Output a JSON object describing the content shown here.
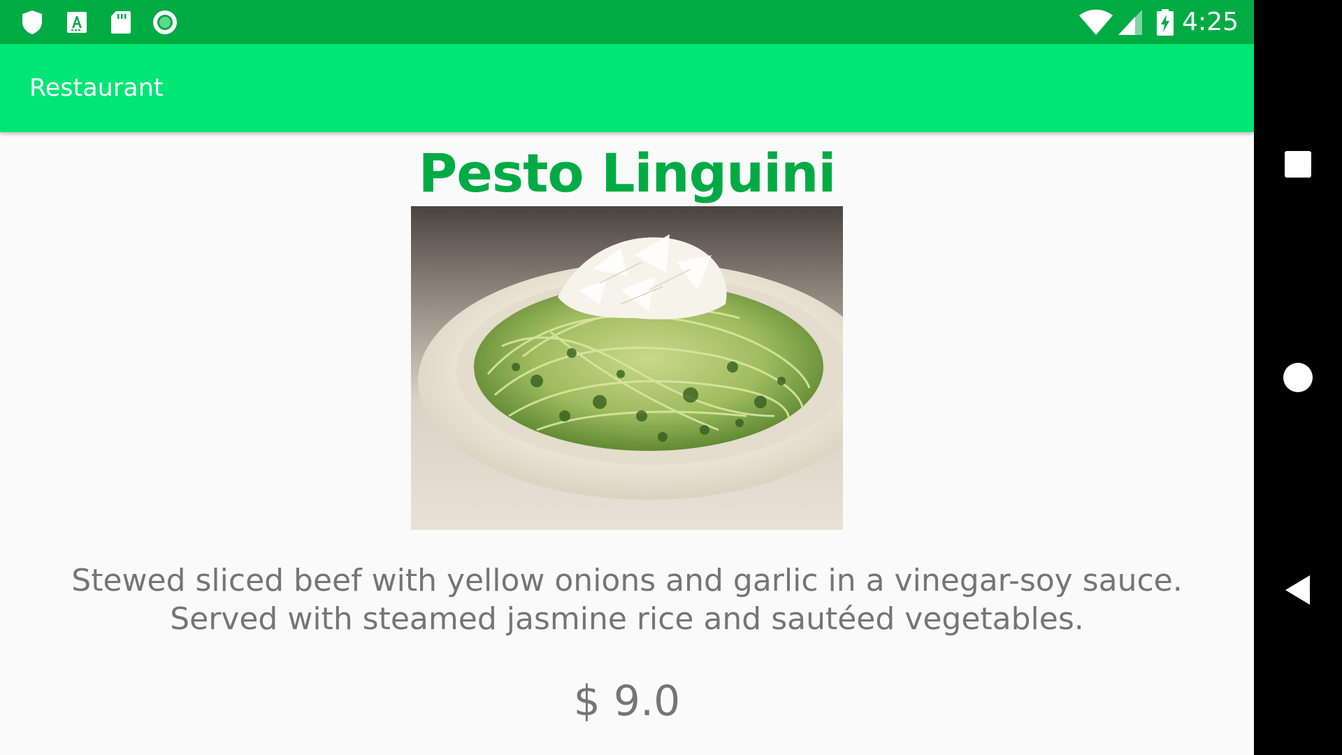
{
  "status_bar": {
    "time": "4:25",
    "left_icons": [
      "shield-icon",
      "text-a-icon",
      "sd-card-icon",
      "record-icon"
    ],
    "right_icons": [
      "wifi-icon",
      "signal-icon",
      "battery-charging-icon"
    ]
  },
  "app_bar": {
    "title": "Restaurant"
  },
  "dish": {
    "name": "Pesto Linguini",
    "image_icon": "pesto-linguini-photo",
    "description": "Stewed sliced beef with yellow onions and garlic in a vinegar-soy sauce. Served with steamed jasmine rice and sautéed vegetables.",
    "price": "$ 9.0"
  },
  "nav_bar": {
    "buttons": [
      "recents-button",
      "home-button",
      "back-button"
    ]
  },
  "colors": {
    "status_bar": "#00ab44",
    "app_bar": "#00e676",
    "title_green": "#00ab44",
    "body_text": "#757575",
    "background": "#fafafa"
  }
}
